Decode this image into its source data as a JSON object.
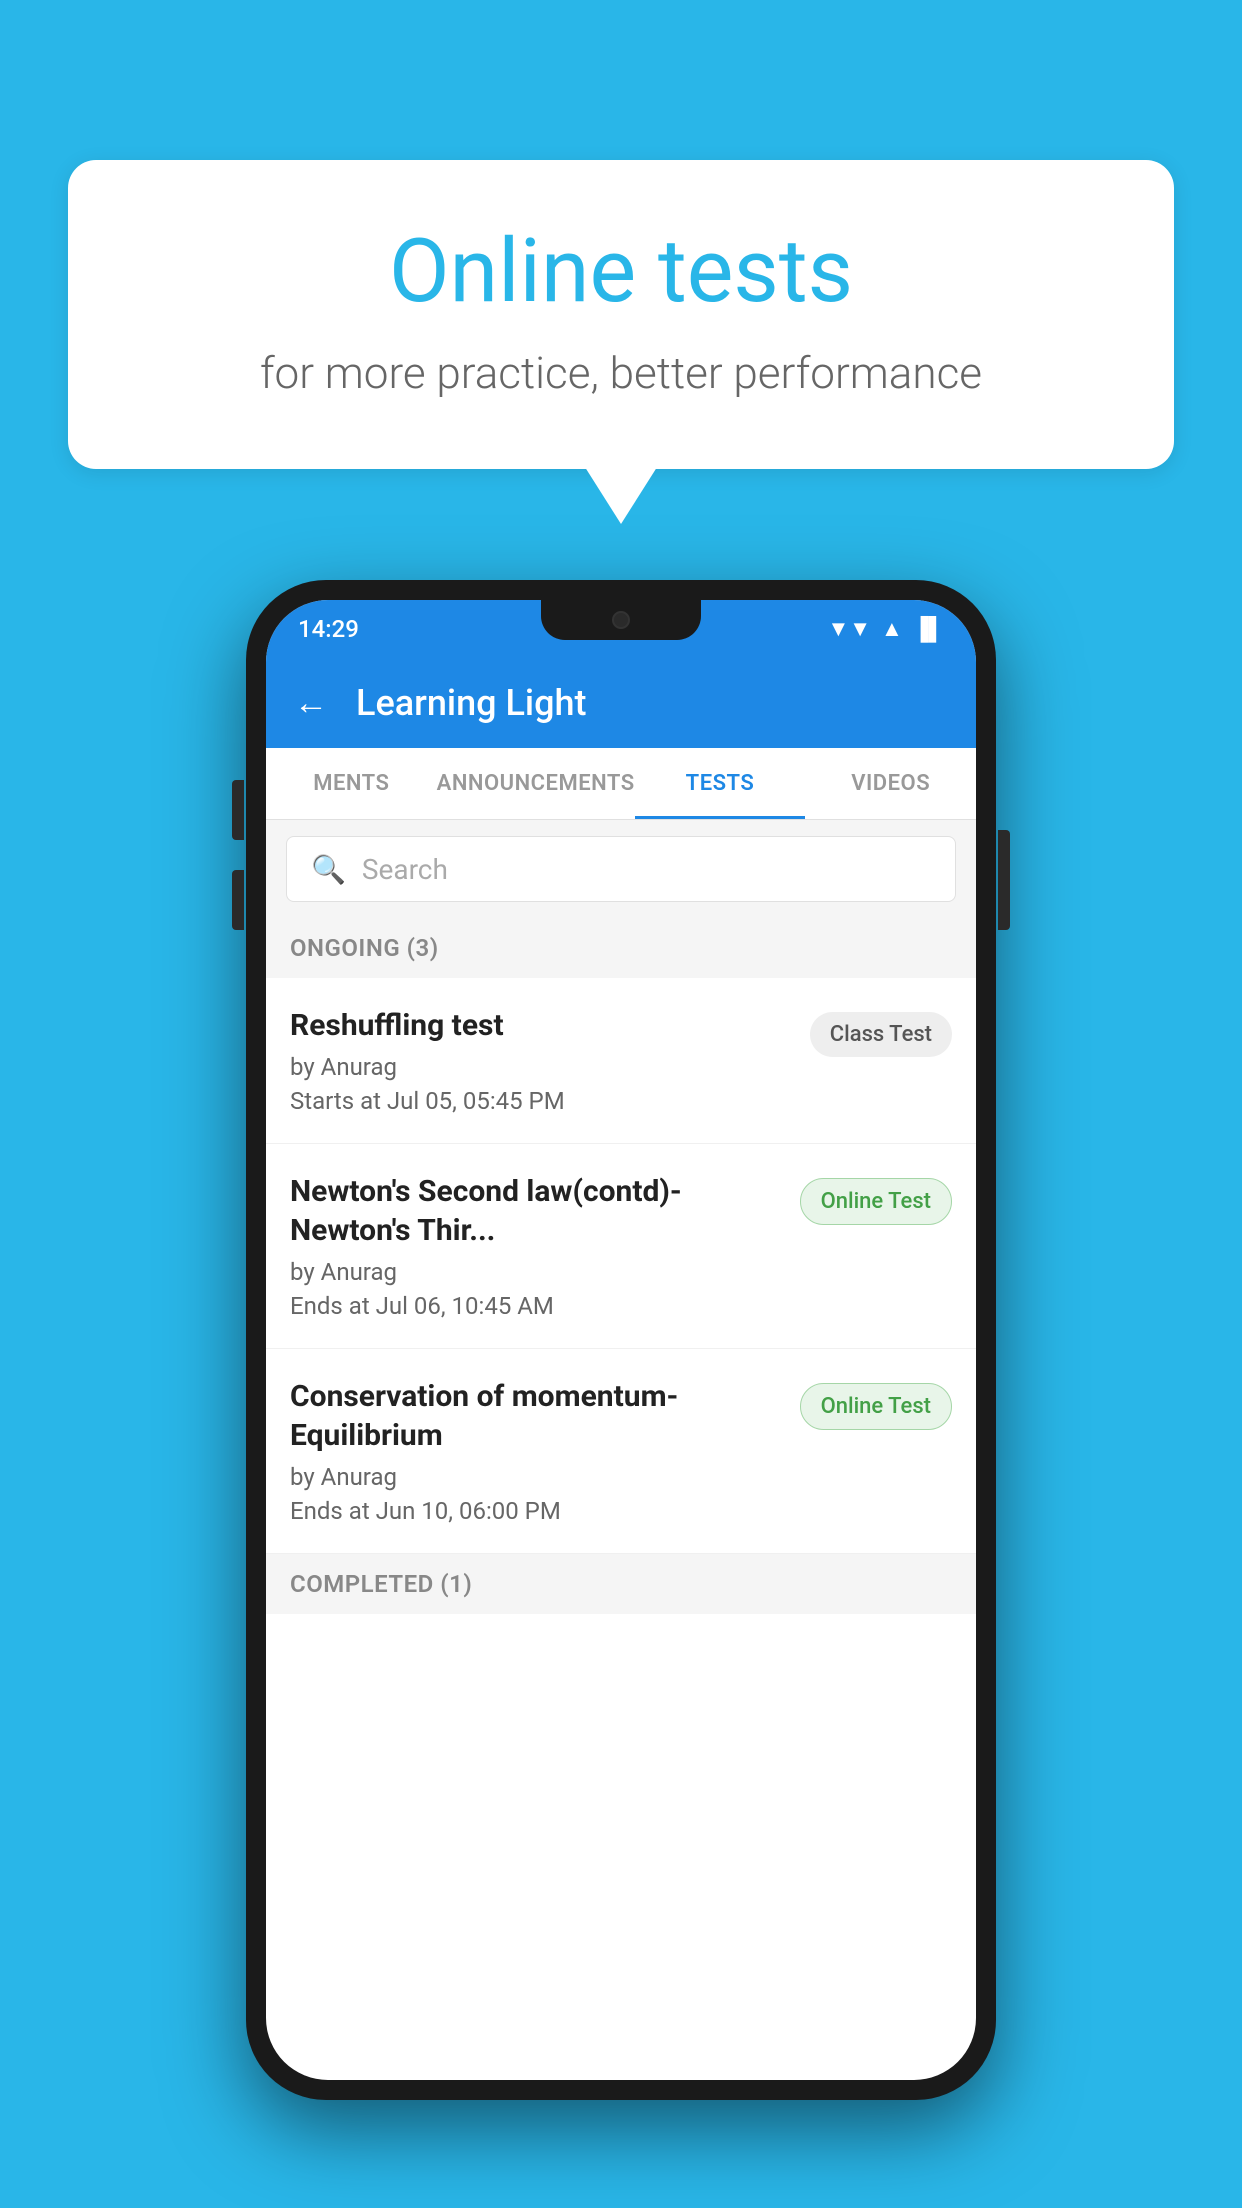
{
  "background_color": "#29b6e8",
  "speech_bubble": {
    "title": "Online tests",
    "subtitle": "for more practice, better performance"
  },
  "status_bar": {
    "time": "14:29",
    "wifi": "▲",
    "signal": "▲",
    "battery": "▐"
  },
  "app_header": {
    "title": "Learning Light",
    "back_label": "←"
  },
  "tabs": [
    {
      "label": "MENTS",
      "active": false
    },
    {
      "label": "ANNOUNCEMENTS",
      "active": false
    },
    {
      "label": "TESTS",
      "active": true
    },
    {
      "label": "VIDEOS",
      "active": false
    }
  ],
  "search": {
    "placeholder": "Search"
  },
  "ongoing_section": {
    "label": "ONGOING (3)"
  },
  "tests": [
    {
      "name": "Reshuffling test",
      "author": "by Anurag",
      "time": "Starts at  Jul 05, 05:45 PM",
      "badge": "Class Test",
      "badge_type": "class"
    },
    {
      "name": "Newton's Second law(contd)-Newton's Thir...",
      "author": "by Anurag",
      "time": "Ends at  Jul 06, 10:45 AM",
      "badge": "Online Test",
      "badge_type": "online"
    },
    {
      "name": "Conservation of momentum-Equilibrium",
      "author": "by Anurag",
      "time": "Ends at  Jun 10, 06:00 PM",
      "badge": "Online Test",
      "badge_type": "online"
    }
  ],
  "completed_section": {
    "label": "COMPLETED (1)"
  }
}
